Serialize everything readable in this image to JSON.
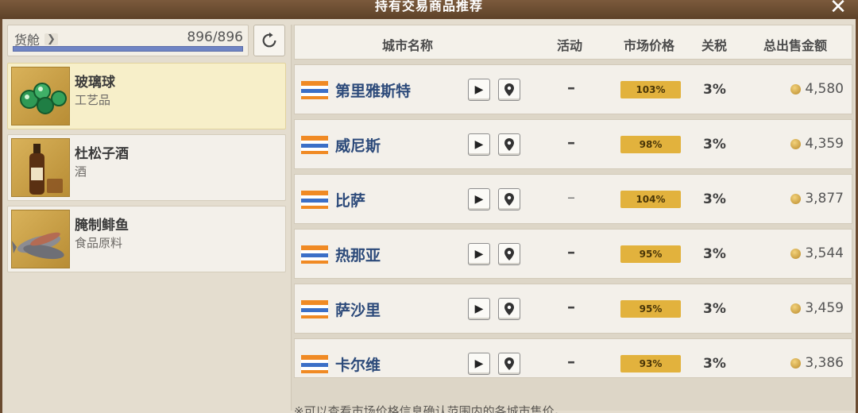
{
  "window": {
    "title": "持有交易商品推荐"
  },
  "cargo": {
    "label": "货舱",
    "value": "896/896",
    "fill_fraction": 1.0
  },
  "goods": [
    {
      "name": "玻璃球",
      "category": "工艺品",
      "selected": true
    },
    {
      "name": "杜松子酒",
      "category": "酒",
      "selected": false
    },
    {
      "name": "腌制鲱鱼",
      "category": "食品原料",
      "selected": false
    }
  ],
  "table": {
    "headers": {
      "city": "城市名称",
      "activity": "活动",
      "price": "市场价格",
      "tax": "关税",
      "total": "总出售金额"
    },
    "rows": [
      {
        "city": "第里雅斯特",
        "activity": "–",
        "price": "103%",
        "tax": "3%",
        "total": "4,580"
      },
      {
        "city": "威尼斯",
        "activity": "–",
        "price": "98%",
        "tax": "3%",
        "total": "4,359"
      },
      {
        "city": "比萨",
        "activity": "–",
        "price": "104%",
        "tax": "3%",
        "total": "3,877"
      },
      {
        "city": "热那亚",
        "activity": "–",
        "price": "95%",
        "tax": "3%",
        "total": "3,544"
      },
      {
        "city": "萨沙里",
        "activity": "–",
        "price": "95%",
        "tax": "3%",
        "total": "3,459"
      },
      {
        "city": "卡尔维",
        "activity": "–",
        "price": "93%",
        "tax": "3%",
        "total": "3,386"
      }
    ]
  },
  "footer_note": "※可以查看市场价格信息确认范围内的各城市售价。",
  "icons": {
    "close": "close-icon",
    "refresh": "refresh-icon",
    "play": "play-icon",
    "map": "map-pin-icon",
    "coin": "coin-icon",
    "flag": "flag-icon"
  },
  "colors": {
    "price_badge": "#e2b23d",
    "city_text": "#2c4a7a",
    "cargo_bar": "#6f84c4",
    "title_bar": "#5d4128",
    "selected_item": "#f7efc9"
  }
}
